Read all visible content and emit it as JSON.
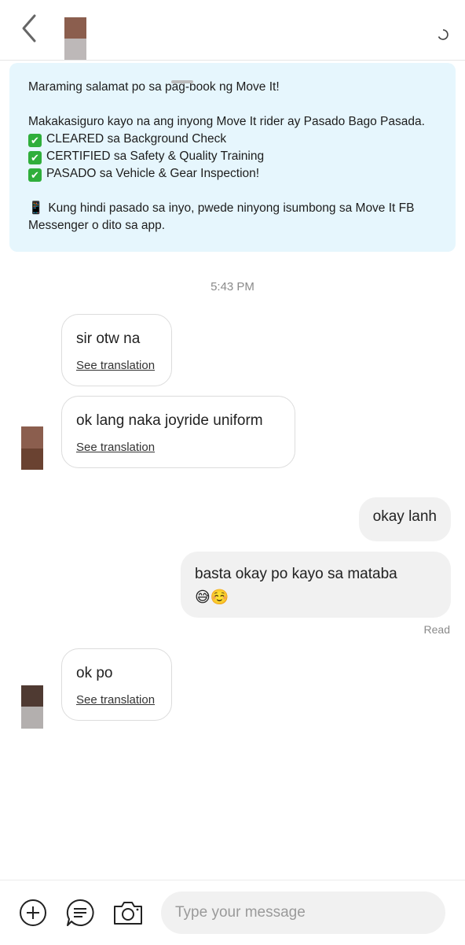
{
  "header": {
    "back_icon": "chevron-left-icon",
    "avatar_colors": [
      "#8b5e4e",
      "#bdb8b8"
    ],
    "status_icon": "loading-spinner-icon"
  },
  "system_card": {
    "line1": "Maraming salamat po sa pag-book ng Move It!",
    "line2": "Makakasiguro kayo na ang inyong Move It rider ay Pasado Bago Pasada.",
    "check_items": [
      "CLEARED sa Background Check",
      "CERTIFIED sa Safety & Quality Training",
      "PASADO sa Vehicle & Gear Inspection!"
    ],
    "footer_line1": "Kung hindi pasado sa inyo, pwede ninyong isumbong sa Move It FB",
    "footer_line2": "Messenger o dito sa app.",
    "background": "#e6f6fd"
  },
  "timestamp": "5:43 PM",
  "messages": [
    {
      "direction": "in",
      "text": "sir otw na",
      "translation_link": "See translation"
    },
    {
      "direction": "in",
      "text": "ok lang naka joyride uniform",
      "translation_link": "See translation"
    },
    {
      "direction": "out",
      "text": "okay lanh"
    },
    {
      "direction": "out",
      "text": "basta okay po kayo sa mataba",
      "emoji": "😅☺️"
    },
    {
      "direction": "in",
      "text": "ok po",
      "translation_link": "See translation"
    }
  ],
  "read_receipt": "Read",
  "sender_avatar_colors": {
    "first": [
      "#8b5e4e",
      "#6a4231"
    ],
    "second": [
      "#4f3a32",
      "#b3afae"
    ]
  },
  "composer": {
    "add_icon": "plus-circle-icon",
    "quick_reply_icon": "chat-lines-icon",
    "camera_icon": "camera-icon",
    "placeholder": "Type your message"
  }
}
